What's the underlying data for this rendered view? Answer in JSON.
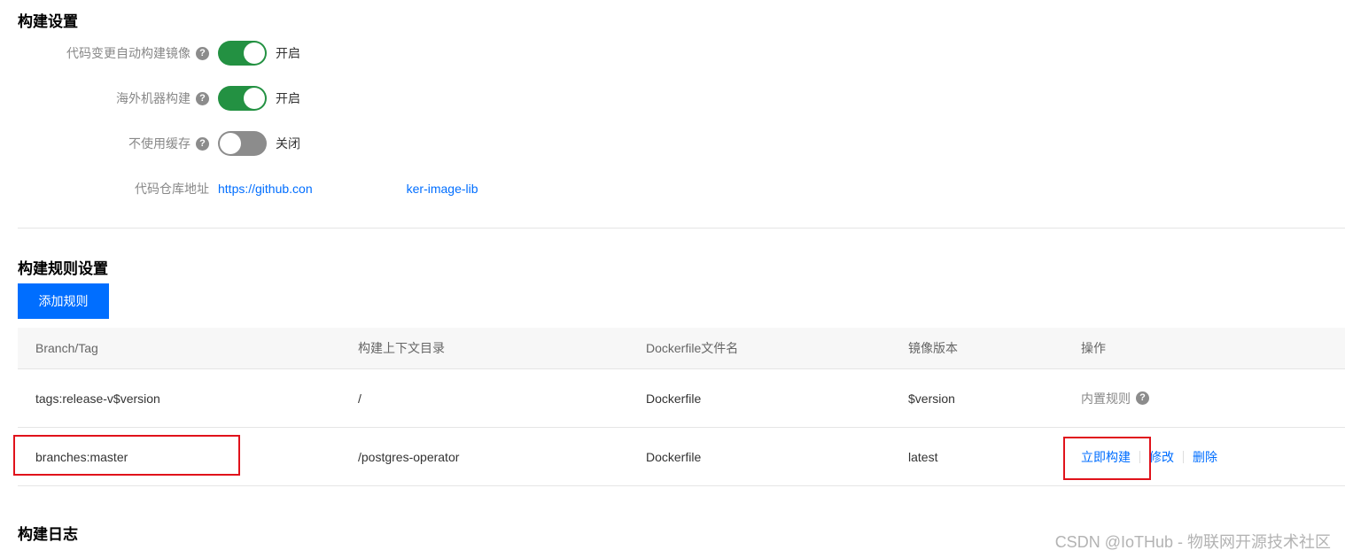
{
  "build_settings": {
    "title": "构建设置",
    "rows": [
      {
        "label": "代码变更自动构建镜像",
        "state": "on",
        "state_text": "开启"
      },
      {
        "label": "海外机器构建",
        "state": "on",
        "state_text": "开启"
      },
      {
        "label": "不使用缓存",
        "state": "off",
        "state_text": "关闭"
      }
    ],
    "repo": {
      "label": "代码仓库地址",
      "url_part1": "https://github.con",
      "url_part2": "ker-image-lib"
    },
    "help_icon": "question-circle-icon",
    "colors": {
      "toggle_on": "#239142",
      "toggle_off": "#8c8c8c",
      "link": "#006eff"
    }
  },
  "rules": {
    "title": "构建规则设置",
    "add_button": "添加规则",
    "columns": [
      "Branch/Tag",
      "构建上下文目录",
      "Dockerfile文件名",
      "镜像版本",
      "操作"
    ],
    "rows": [
      {
        "branch": "tags:release-v$version",
        "context": "/",
        "dockerfile": "Dockerfile",
        "version": "$version",
        "ops_text": "内置规则"
      },
      {
        "branch": "branches:master",
        "context": "/postgres-operator",
        "dockerfile": "Dockerfile",
        "version": "latest",
        "ops": [
          "立即构建",
          "修改",
          "删除"
        ]
      }
    ]
  },
  "build_log": {
    "title": "构建日志"
  },
  "watermark": "CSDN @IoTHub - 物联网开源技术社区"
}
